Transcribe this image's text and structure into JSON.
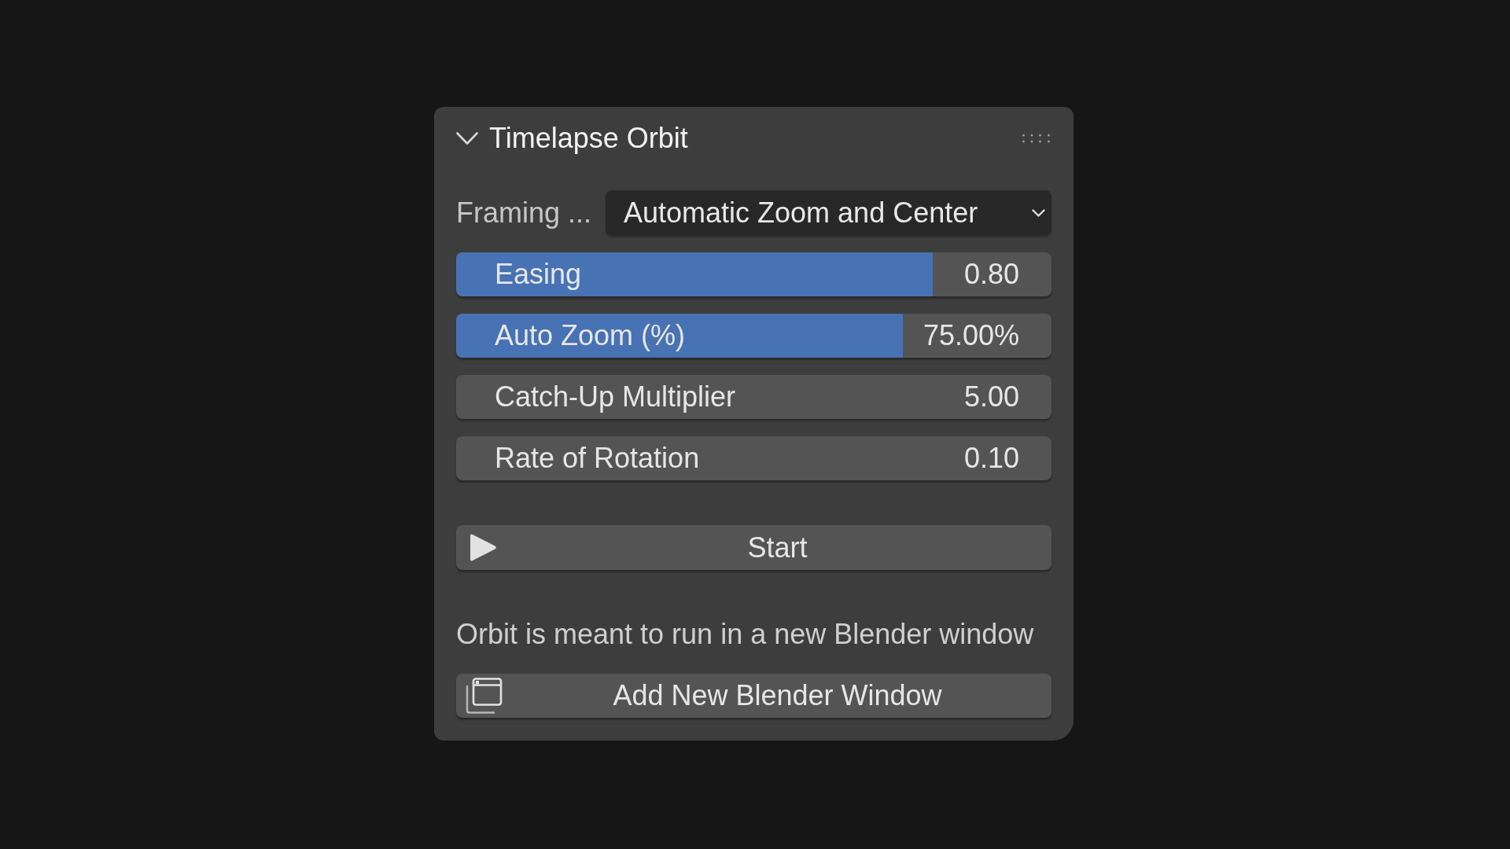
{
  "panel": {
    "title": "Timelapse Orbit",
    "expanded": true
  },
  "framing": {
    "label": "Framing ...",
    "value": "Automatic Zoom and Center"
  },
  "fields": [
    {
      "kind": "slider",
      "label": "Easing",
      "value": "0.80",
      "level": 0.8
    },
    {
      "kind": "slider",
      "label": "Auto Zoom (%)",
      "value": "75.00%",
      "level": 0.75
    },
    {
      "kind": "number",
      "label": "Catch-Up Multiplier",
      "value": "5.00"
    },
    {
      "kind": "number",
      "label": "Rate of Rotation",
      "value": "0.10"
    }
  ],
  "start_button": {
    "label": "Start"
  },
  "note": "Orbit is meant to run in a new Blender window",
  "window_button": {
    "label": "Add New Blender Window"
  }
}
